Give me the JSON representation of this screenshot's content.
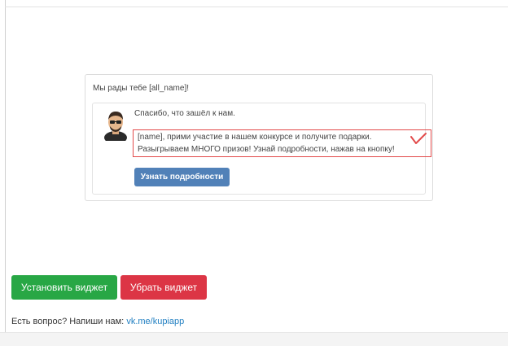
{
  "widget_preview": {
    "greeting": "Мы рады тебе [all_name]!",
    "message": {
      "line1": "Спасибо, что зашёл к нам.",
      "line2": "[name], прими участие в нашем конкурсе и получите подарки.",
      "line3": "Разыгрываем МНОГО призов! Узнай подробности, нажав на кнопку!",
      "button_label": "Узнать подробности"
    },
    "highlight_color": "#e24a4a",
    "button_color": "#5181b8"
  },
  "actions": {
    "install_label": "Установить виджет",
    "remove_label": "Убрать виджет",
    "install_color": "#28a745",
    "remove_color": "#dc3545"
  },
  "contact": {
    "prompt": "Есть вопрос? Напиши нам:",
    "link_text": "vk.me/kupiapp",
    "link_color": "#1f7ec1"
  }
}
